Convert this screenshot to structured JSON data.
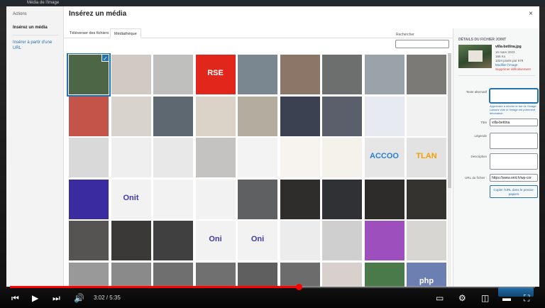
{
  "wp_bar": {
    "text": "Média de l'image"
  },
  "menu": {
    "heading": "Actions",
    "active_item": "Insérez un média",
    "url_item": "Insérer à partir d'une URL"
  },
  "modal": {
    "title": "Insérez un média",
    "close_icon": "close-icon",
    "tabs": [
      "Téléverser des fichiers",
      "Médiathèque"
    ],
    "search_label": "Rechercher",
    "search_value": ""
  },
  "grid": {
    "selected_index": 0,
    "items": [
      {
        "label": "",
        "bg": "#4d6645",
        "fg": "#fff",
        "alt": "villa-bettina"
      },
      {
        "label": "",
        "bg": "#d0c9c4",
        "fg": "#222"
      },
      {
        "label": "",
        "bg": "#bfc0bd",
        "fg": "#222"
      },
      {
        "label": "RSE",
        "bg": "#e1261c",
        "fg": "#fff"
      },
      {
        "label": "",
        "bg": "#7b8790",
        "fg": "#222"
      },
      {
        "label": "",
        "bg": "#8b7668",
        "fg": "#222"
      },
      {
        "label": "",
        "bg": "#6d6f6e",
        "fg": "#222"
      },
      {
        "label": "",
        "bg": "#9aa3aa",
        "fg": "#222"
      },
      {
        "label": "",
        "bg": "#7c7a76",
        "fg": "#222"
      },
      {
        "label": "",
        "bg": "#c4534a",
        "fg": "#222"
      },
      {
        "label": "",
        "bg": "#d8d3cd",
        "fg": "#222"
      },
      {
        "label": "",
        "bg": "#5d6870",
        "fg": "#222"
      },
      {
        "label": "",
        "bg": "#dcd3c8",
        "fg": "#222"
      },
      {
        "label": "",
        "bg": "#b5aca0",
        "fg": "#222"
      },
      {
        "label": "",
        "bg": "#3b4150",
        "fg": "#222"
      },
      {
        "label": "",
        "bg": "#5a5f6b",
        "fg": "#222"
      },
      {
        "label": "",
        "bg": "#e7eaf0",
        "fg": "#222"
      },
      {
        "label": "",
        "bg": "#f1f1f1",
        "fg": "#222"
      },
      {
        "label": "",
        "bg": "#d9d9d9",
        "fg": "#222"
      },
      {
        "label": "",
        "bg": "#efefef",
        "fg": "#222"
      },
      {
        "label": "",
        "bg": "#e8e8e8",
        "fg": "#222"
      },
      {
        "label": "",
        "bg": "#c4c3c1",
        "fg": "#222"
      },
      {
        "label": "",
        "bg": "#f3f3f3",
        "fg": "#222"
      },
      {
        "label": "",
        "bg": "#f7f4ef",
        "fg": "#222"
      },
      {
        "label": "",
        "bg": "#f5f2ec",
        "fg": "#222"
      },
      {
        "label": "ACCOO",
        "bg": "#e6e6e6",
        "fg": "#2b7fd1"
      },
      {
        "label": "TLAN",
        "bg": "#e2e2e2",
        "fg": "#f1a000"
      },
      {
        "label": "",
        "bg": "#3b2ba0",
        "fg": "#fff"
      },
      {
        "label": "Onit",
        "bg": "#f2f2f2",
        "fg": "#3f3aa4"
      },
      {
        "label": "",
        "bg": "#f2f2f2",
        "fg": "#222"
      },
      {
        "label": "",
        "bg": "#f2f2f2",
        "fg": "#222"
      },
      {
        "label": "",
        "bg": "#5e6062",
        "fg": "#222"
      },
      {
        "label": "",
        "bg": "#2f2d2b",
        "fg": "#222"
      },
      {
        "label": "",
        "bg": "#2f3135",
        "fg": "#222"
      },
      {
        "label": "",
        "bg": "#2d2c2a",
        "fg": "#222"
      },
      {
        "label": "",
        "bg": "#353330",
        "fg": "#222"
      },
      {
        "label": "",
        "bg": "#555453",
        "fg": "#222"
      },
      {
        "label": "",
        "bg": "#3a3937",
        "fg": "#222"
      },
      {
        "label": "",
        "bg": "#404040",
        "fg": "#222"
      },
      {
        "label": "Oni",
        "bg": "#f2f2f2",
        "fg": "#3f3aa4"
      },
      {
        "label": "Oni",
        "bg": "#f2f2f2",
        "fg": "#3f3aa4"
      },
      {
        "label": "",
        "bg": "#ececec",
        "fg": "#222"
      },
      {
        "label": "",
        "bg": "#cfcfcf",
        "fg": "#222"
      },
      {
        "label": "",
        "bg": "#9d4fbd",
        "fg": "#222"
      },
      {
        "label": "",
        "bg": "#d8d6d3",
        "fg": "#222"
      },
      {
        "label": "",
        "bg": "#999",
        "fg": "#222"
      },
      {
        "label": "",
        "bg": "#8a8a8a",
        "fg": "#222"
      },
      {
        "label": "",
        "bg": "#6f6f6f",
        "fg": "#222"
      },
      {
        "label": "",
        "bg": "#707070",
        "fg": "#222"
      },
      {
        "label": "",
        "bg": "#5f5f5f",
        "fg": "#222"
      },
      {
        "label": "",
        "bg": "#6c6c6c",
        "fg": "#222"
      },
      {
        "label": "",
        "bg": "#d7d0cc",
        "fg": "#222"
      },
      {
        "label": "",
        "bg": "#4b7a4a",
        "fg": "#222"
      },
      {
        "label": "php",
        "bg": "#6c7fb3",
        "fg": "#fff"
      }
    ]
  },
  "details": {
    "heading": "DÉTAILS DU FICHIER JOINT",
    "filename": "villa-bettina.jpg",
    "date": "16 mars 2023",
    "size": "166 Ko",
    "dimensions": "1024 pixels par 679",
    "edit_link": "Modifier l'image",
    "delete_link": "Supprimer définitivement",
    "alt_label": "Texte alternatif",
    "alt_value": "",
    "alt_help": "Apprendre à décrire le but de l'image. Laissez vide si l'image est purement décorative.",
    "title_label": "Titre",
    "title_value": "villa-bettina",
    "legend_label": "Légende",
    "legend_value": "",
    "desc_label": "Description",
    "desc_value": "",
    "url_label": "URL du fichier :",
    "url_value": "https://www.onit.fr/wp-cor",
    "copy_button": "Copier l'URL dans le presse-papiers"
  },
  "player": {
    "time": "3:02 / 5:35",
    "progress": 0.55,
    "accent": "#ff0000"
  }
}
